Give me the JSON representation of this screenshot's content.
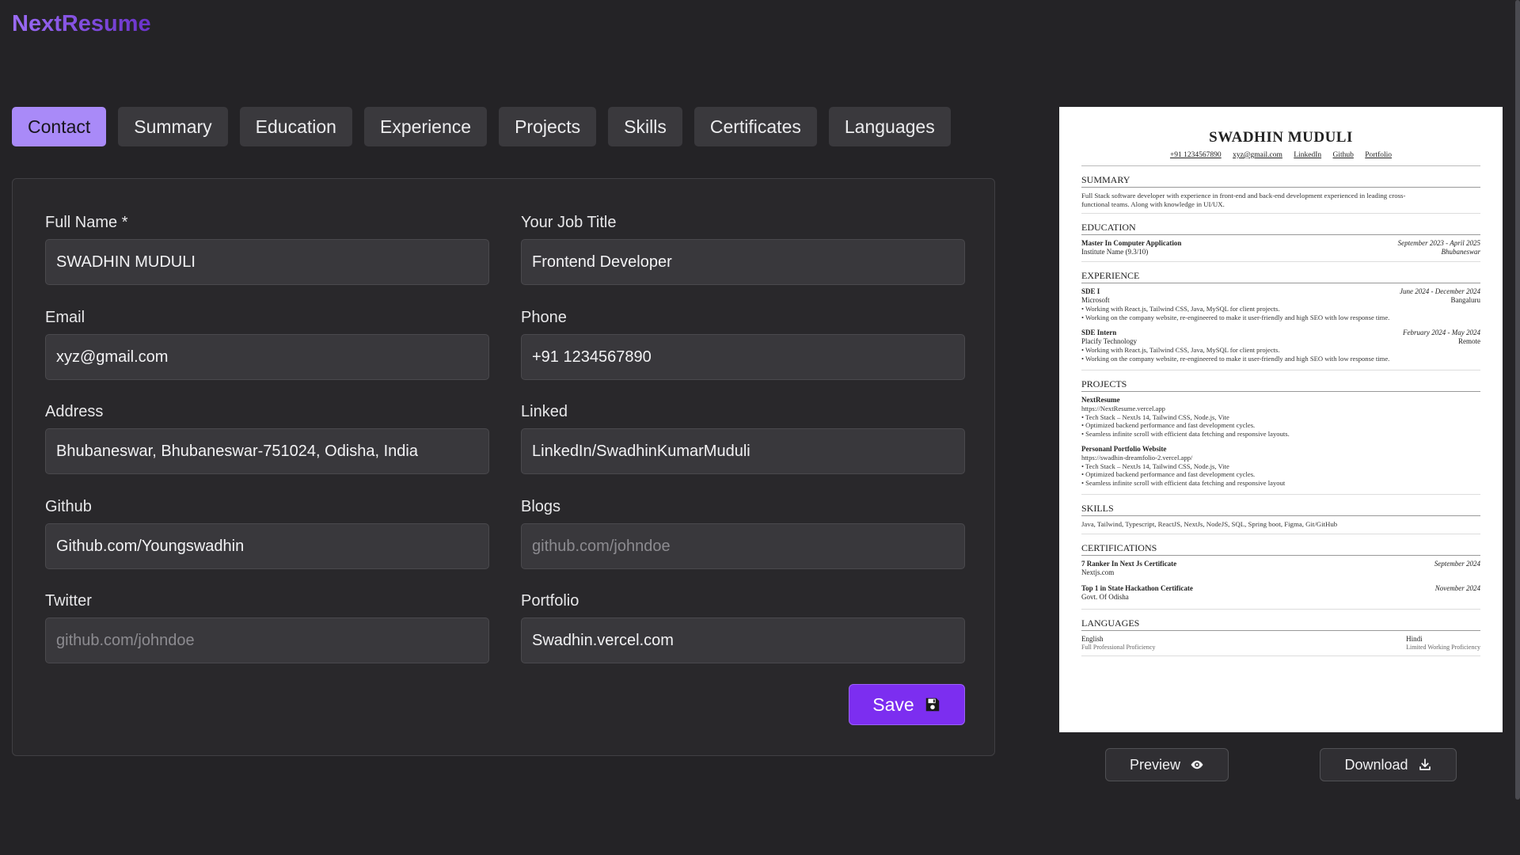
{
  "app": {
    "title": "NextResume"
  },
  "tabs": [
    {
      "label": "Contact",
      "active": true
    },
    {
      "label": "Summary",
      "active": false
    },
    {
      "label": "Education",
      "active": false
    },
    {
      "label": "Experience",
      "active": false
    },
    {
      "label": "Projects",
      "active": false
    },
    {
      "label": "Skills",
      "active": false
    },
    {
      "label": "Certificates",
      "active": false
    },
    {
      "label": "Languages",
      "active": false
    }
  ],
  "form": {
    "full_name": {
      "label": "Full Name *",
      "value": "SWADHIN MUDULI"
    },
    "job_title": {
      "label": "Your Job Title",
      "value": "Frontend Developer"
    },
    "email": {
      "label": "Email",
      "value": "xyz@gmail.com"
    },
    "phone": {
      "label": "Phone",
      "value": "+91 1234567890"
    },
    "address": {
      "label": "Address",
      "value": "Bhubaneswar, Bhubaneswar-751024, Odisha, India"
    },
    "linked": {
      "label": "Linked",
      "value": "LinkedIn/SwadhinKumarMuduli"
    },
    "github": {
      "label": "Github",
      "value": "Github.com/Youngswadhin"
    },
    "blogs": {
      "label": "Blogs",
      "value": "",
      "placeholder": "github.com/johndoe"
    },
    "twitter": {
      "label": "Twitter",
      "value": "",
      "placeholder": "github.com/johndoe"
    },
    "portfolio": {
      "label": "Portfolio",
      "value": "Swadhin.vercel.com"
    },
    "save_label": "Save"
  },
  "resume": {
    "name": "SWADHIN MUDULI",
    "links": [
      "+91 1234567890",
      "xyz@gmail.com",
      "LinkedIn",
      "Github",
      "Portfolio"
    ],
    "summary": {
      "heading": "SUMMARY",
      "text": "Full Stack software developer with experience in front-end and back-end development experienced in leading cross-functional teams. Along with knowledge in UI/UX."
    },
    "education": {
      "heading": "EDUCATION",
      "degree": "Master In Computer Application",
      "dates": "September 2023 - April 2025",
      "institute": "Institute Name (9.3/10)",
      "location": "Bhubaneswar"
    },
    "experience": {
      "heading": "EXPERIENCE",
      "items": [
        {
          "role": "SDE I",
          "dates": "June 2024 - December 2024",
          "company": "Microsoft",
          "location": "Bangaluru",
          "bullets": [
            "• Working with React.js, Tailwind CSS, Java, MySQL for client projects.",
            "• Working on the company website, re-engineered to make it user-friendly and high SEO with low response time."
          ]
        },
        {
          "role": "SDE Intern",
          "dates": "February 2024 - May 2024",
          "company": "Placify Technology",
          "location": "Remote",
          "bullets": [
            "• Working with React.js, Tailwind CSS, Java, MySQL for client projects.",
            "• Working on the company website, re-engineered to make it user-friendly and high SEO with low response time."
          ]
        }
      ]
    },
    "projects": {
      "heading": "PROJECTS",
      "items": [
        {
          "name": "NextResume",
          "url": "https://NextResume.vercel.app",
          "bullets": [
            "• Tech Stack – NextJs 14, Tailwind CSS, Node.js, Vite",
            "• Optimized backend performance and fast development cycles.",
            "• Seamless infinite scroll with efficient data fetching and responsive layouts."
          ]
        },
        {
          "name": "Personanl Portfolio Website",
          "url": "https://swadhin-dreamfolio-2.vercel.app/",
          "bullets": [
            "• Tech Stack – NextJs 14, Tailwind CSS, Node.js, Vite",
            "• Optimized backend performance and fast development cycles.",
            "• Seamless infinite scroll with efficient data fetching and responsive layout"
          ]
        }
      ]
    },
    "skills": {
      "heading": "SKILLS",
      "text": "Java, Tailwind, Typescript, ReactJS, NextJs, NodeJS, SQL, Spring boot, Figma, Git/GitHub"
    },
    "certifications": {
      "heading": "CERTIFICATIONS",
      "items": [
        {
          "name": "7 Ranker In Next Js Certificate",
          "date": "September 2024",
          "issuer": "Nextjs.com"
        },
        {
          "name": "Top 1 in State Hackathon Certificate",
          "date": "November 2024",
          "issuer": "Govt. Of Odisha"
        }
      ]
    },
    "languages": {
      "heading": "LANGUAGES",
      "items": [
        {
          "name": "English",
          "level": "Full Professional Proficiency"
        },
        {
          "name": "Hindi",
          "level": "Limited Working Proficiency"
        }
      ]
    }
  },
  "actions": {
    "preview_label": "Preview",
    "download_label": "Download"
  },
  "icons": {
    "save": "floppy-disk-icon",
    "preview": "eye-icon",
    "download": "download-icon"
  },
  "colors": {
    "accent": "#7c2ef0",
    "active_tab": "#a98af8",
    "background": "#242326"
  }
}
